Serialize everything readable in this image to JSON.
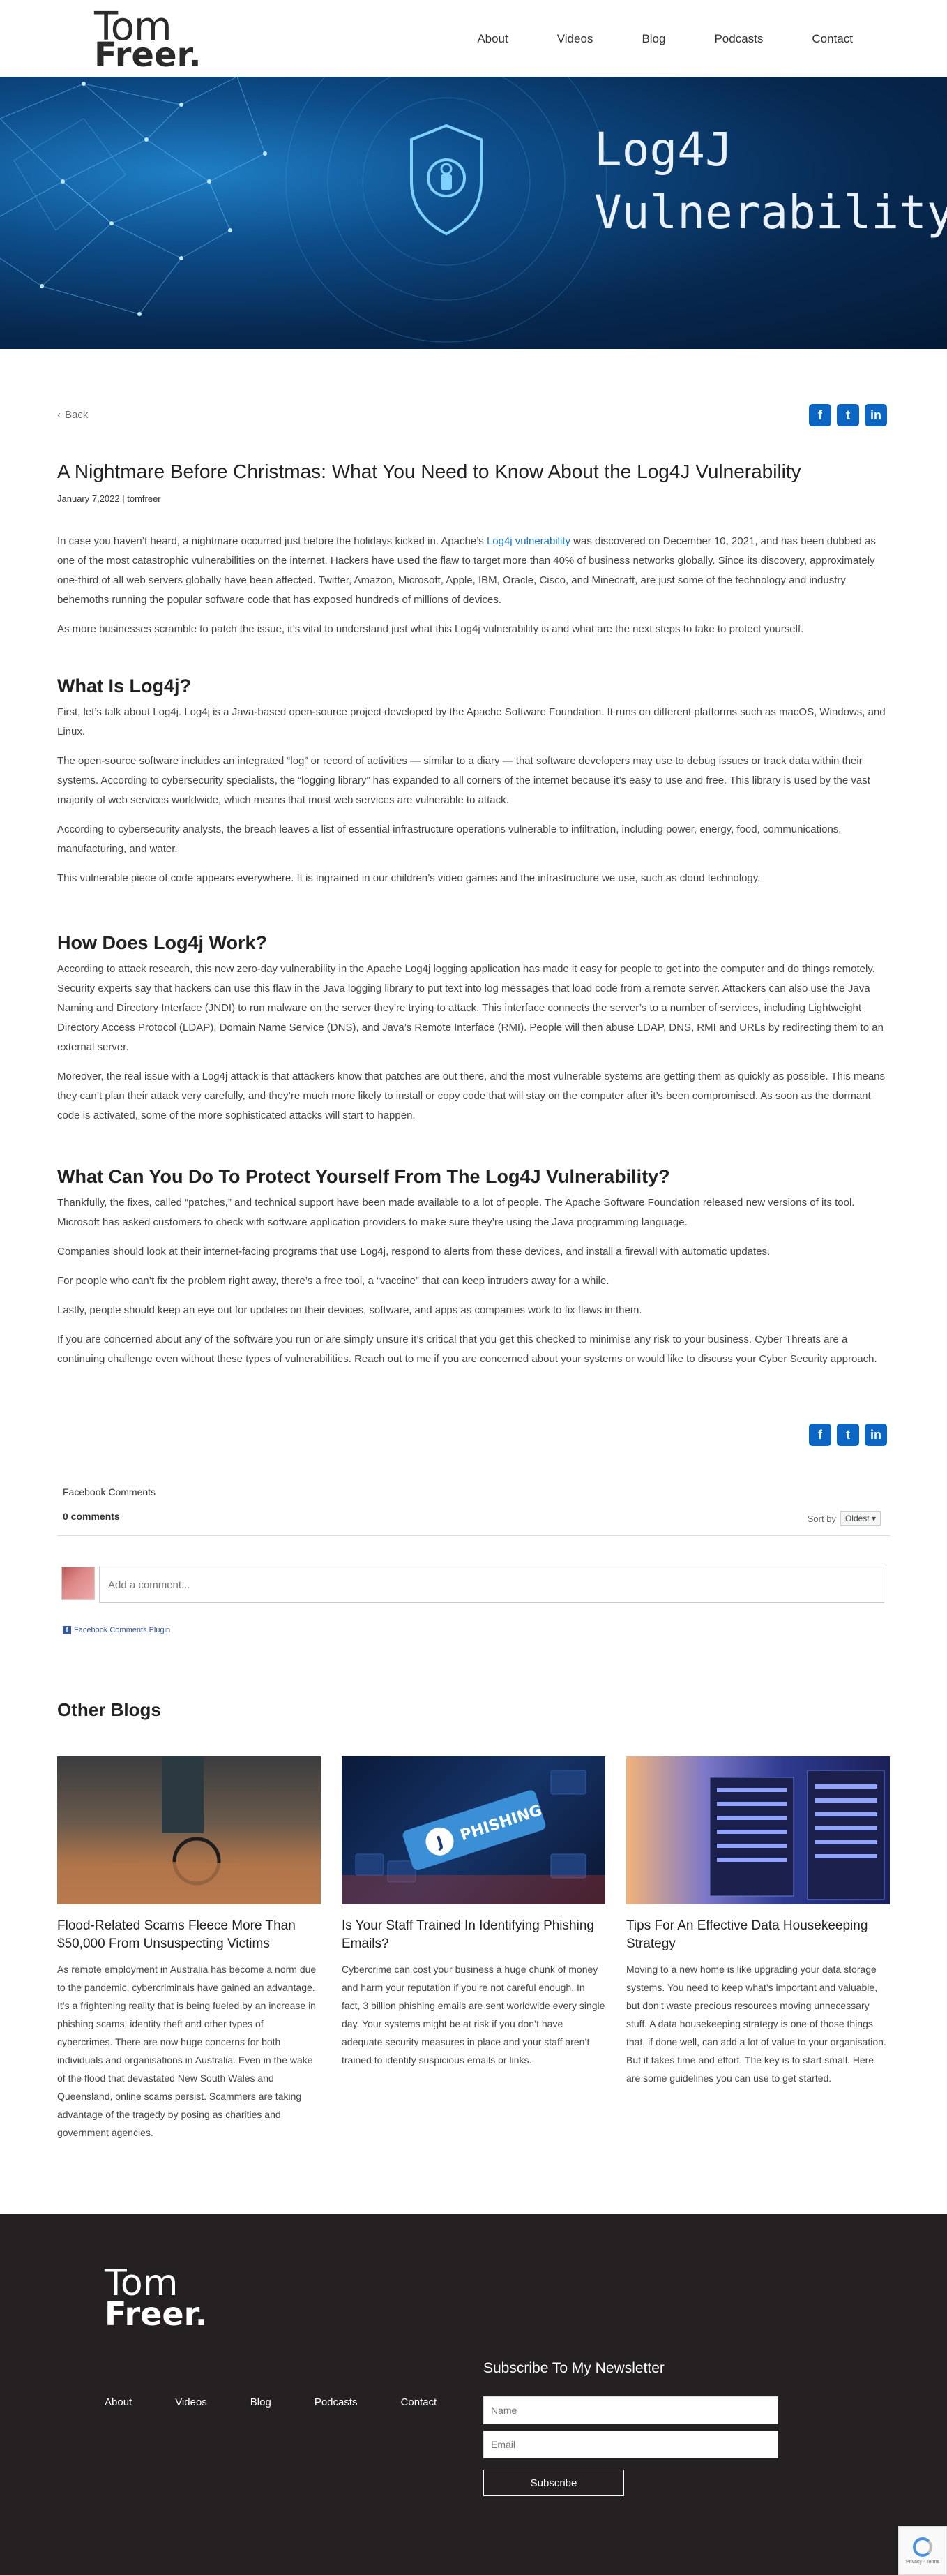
{
  "header": {
    "logo_line1": "Tom",
    "logo_line2": "Freer.",
    "nav": [
      "About",
      "Videos",
      "Blog",
      "Podcasts",
      "Contact"
    ]
  },
  "hero": {
    "title_line1": "Log4J",
    "title_line2": "Vulnerability"
  },
  "article": {
    "back_label": "Back",
    "title": "A Nightmare Before Christmas: What You Need to Know About the Log4J Vulnerability",
    "meta": "January 7,2022 | tomfreer",
    "intro_p1_a": "In case you haven’t heard, a nightmare occurred just before the holidays kicked in. Apache’s ",
    "intro_p1_link": "Log4j vulnerability",
    "intro_p1_b": " was discovered on December 10, 2021, and has been dubbed as one of the most catastrophic vulnerabilities on the internet. Hackers have used the flaw to target more than 40% of business networks globally. Since its discovery, approximately one-third of all web servers globally have been affected. Twitter, Amazon, Microsoft, Apple, IBM, Oracle, Cisco, and Minecraft, are just some of the technology and industry behemoths running the popular software code that has exposed hundreds of millions of devices.",
    "intro_p2": "As more businesses scramble to patch the issue, it’s vital to understand just what this Log4j vulnerability is and what are the next steps to take to protect yourself.",
    "h_what": "What Is Log4j?",
    "what_p1": "First, let’s talk about Log4j. Log4j is a Java-based open-source project developed by the Apache Software Foundation. It runs on different platforms such as macOS, Windows, and Linux.",
    "what_p2": "The open-source software includes an integrated “log” or record of activities — similar to a diary — that software developers may use to debug issues or track data within their systems. According to cybersecurity specialists, the “logging library” has expanded to all corners of the internet because it’s easy to use and free. This library is used by the vast majority of web services worldwide, which means that most web services are vulnerable to attack.",
    "what_p3": "According to cybersecurity analysts, the breach leaves a list of essential infrastructure operations vulnerable to infiltration, including power, energy, food, communications, manufacturing, and water.",
    "what_p4": "This vulnerable piece of code appears everywhere. It is ingrained in our children’s video games and the infrastructure we use, such as cloud technology.",
    "h_how": "How Does Log4j Work?",
    "how_p1": "According to attack research, this new zero-day vulnerability in the Apache Log4j logging application has made it easy for people to get into the computer and do things remotely. Security experts say that hackers can use this flaw in the Java logging library to put text into log messages that load code from a remote server. Attackers can also use the Java Naming and Directory Interface (JNDI) to run malware on the server they’re trying to attack. This interface connects the server’s to a number of services, including Lightweight Directory Access Protocol (LDAP), Domain Name Service (DNS), and Java’s Remote Interface (RMI). People will then abuse LDAP, DNS, RMI and URLs by redirecting them to an external server.",
    "how_p2": "Moreover, the real issue with a Log4j attack is that attackers know that patches are out there, and the most vulnerable systems are getting them as quickly as possible. This means they can’t plan their attack very carefully, and they’re much more likely to install or copy code that will stay on the computer after it’s been compromised. As soon as the dormant code is activated, some of the more sophisticated attacks will start to happen.",
    "h_protect": "What Can You Do To Protect Yourself From The Log4J Vulnerability?",
    "protect_p1": "Thankfully, the fixes, called “patches,” and technical support have been made available to a lot of people. The Apache Software Foundation released new versions of its tool. Microsoft has asked customers to check with software application providers to make sure they’re using the Java programming language.",
    "protect_p2": "Companies should look at their internet-facing programs that use Log4j, respond to alerts from these devices, and install a firewall with automatic updates.",
    "protect_p3": "For people who can’t fix the problem right away, there’s a free tool, a “vaccine” that can keep intruders away for a while.",
    "protect_p4": "Lastly, people should keep an eye out for updates on their devices, software, and apps as companies work to fix flaws in them.",
    "protect_p5": "If you are concerned about any of the software you run or are simply unsure it’s critical that you get this checked to minimise any risk to your business. Cyber Threats are a continuing challenge even without these types of vulnerabilities. Reach out to me if you are concerned about your systems or would like to discuss your Cyber Security approach."
  },
  "share": {
    "facebook": "f",
    "twitter": "t",
    "linkedin": "in"
  },
  "comments": {
    "title": "Facebook Comments",
    "count": "0 comments",
    "sort_label": "Sort by",
    "sort_value": "Oldest",
    "placeholder": "Add a comment...",
    "plugin_label": "Facebook Comments Plugin"
  },
  "other_blogs": {
    "title": "Other Blogs",
    "cards": [
      {
        "title": "Flood-Related Scams Fleece More Than $50,000 From Unsuspecting Victims",
        "excerpt": "As remote employment in Australia has become a norm due to the pandemic, cybercriminals have gained an advantage. It’s a frightening reality that is being fueled by an increase in phishing scams, identity theft and other types of cybercrimes. There are now huge concerns for both individuals and organisations in Australia. Even in the wake of the flood that devastated New South Wales and Queensland, online scams persist. Scammers are taking advantage of the tragedy by posing as charities and government agencies."
      },
      {
        "title": "Is Your Staff Trained In Identifying Phishing Emails?",
        "excerpt": "Cybercrime can cost your business a huge chunk of money and harm your reputation if you’re not careful enough. In fact, 3 billion phishing emails are sent worldwide every single day. Your systems might be at risk if you don’t have adequate security measures in place and your staff aren’t trained to identify suspicious emails or links.",
        "img_text": "PHISHING"
      },
      {
        "title": "Tips For An Effective Data Housekeeping Strategy",
        "excerpt": "Moving to a new home is like upgrading your data storage systems. You need to keep what’s important and valuable, but don’t waste precious resources moving unnecessary stuff. A data housekeeping strategy is one of those things that, if done well, can add a lot of value to your organisation. But it takes time and effort. The key is to start small. Here are some guidelines you can use to get started."
      }
    ]
  },
  "footer": {
    "logo_line1": "Tom",
    "logo_line2": "Freer.",
    "nav": [
      "About",
      "Videos",
      "Blog",
      "Podcasts",
      "Contact"
    ],
    "newsletter_title": "Subscribe To My Newsletter",
    "name_placeholder": "Name",
    "email_placeholder": "Email",
    "subscribe_label": "Subscribe",
    "recaptcha_text": "Privacy - Terms"
  },
  "colors": {
    "accent": "#0a66c2",
    "link": "#1a74c4",
    "footer_bg": "#252122"
  }
}
